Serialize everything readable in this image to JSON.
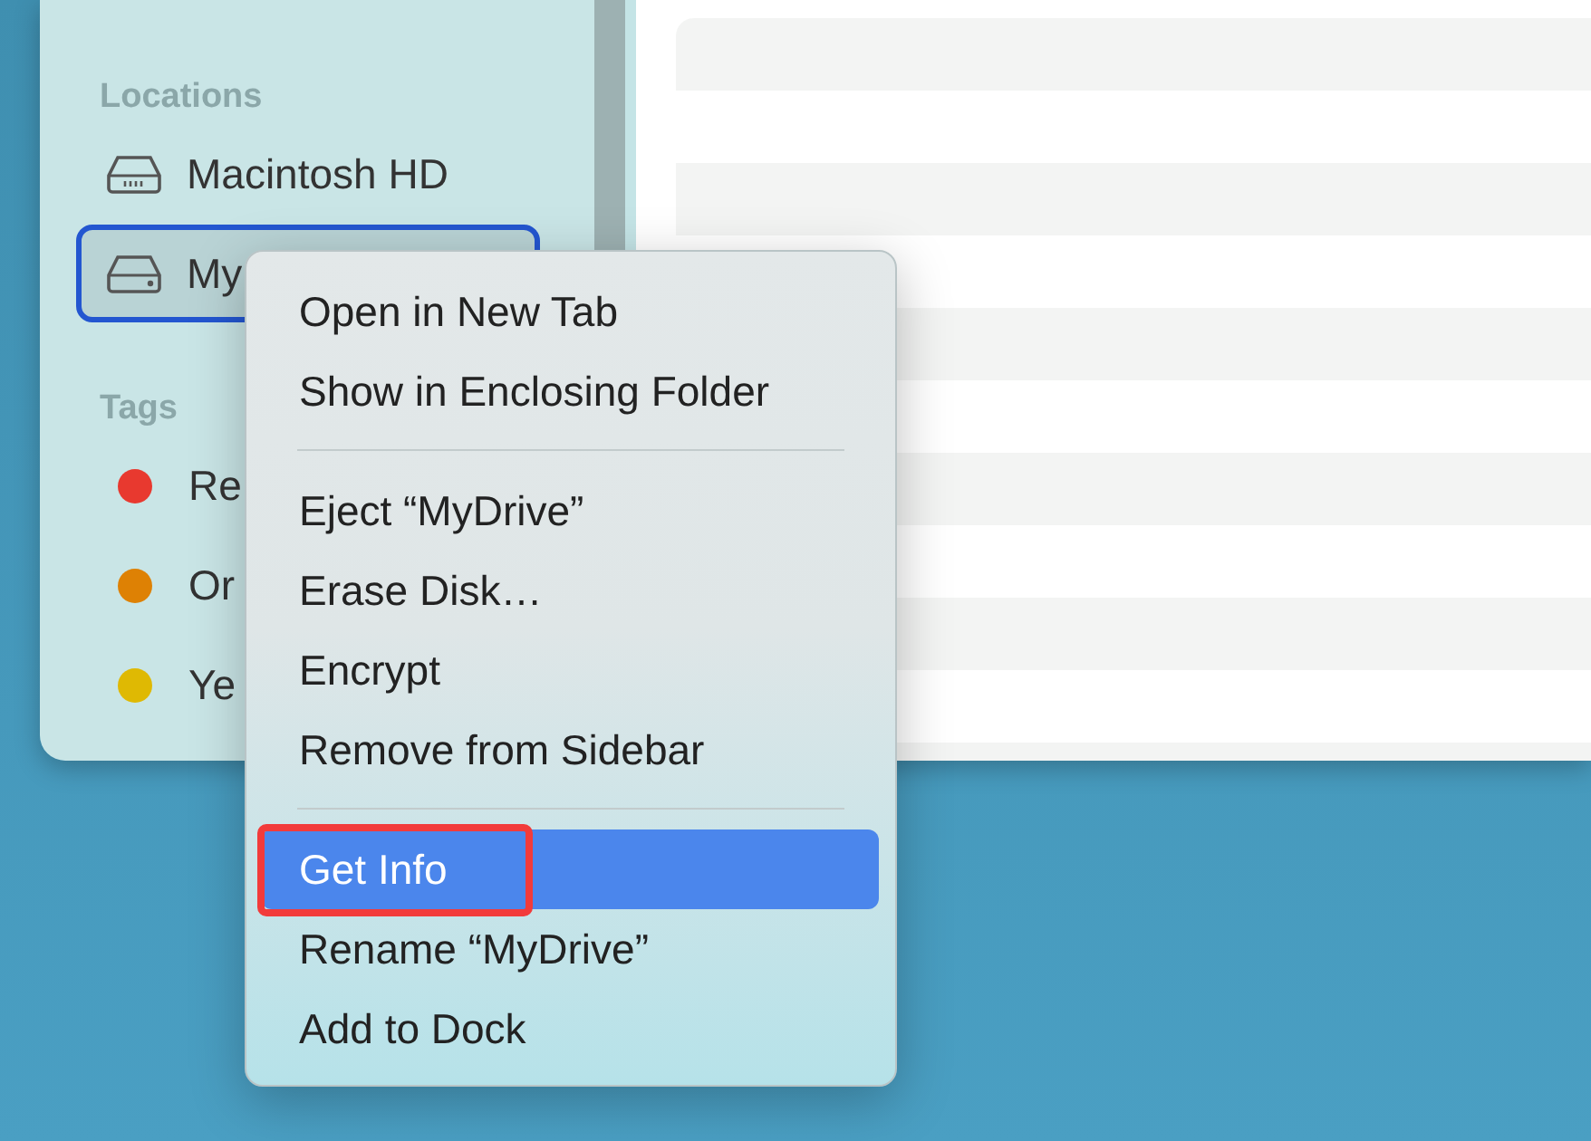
{
  "sidebar": {
    "sections": [
      {
        "header": "Locations",
        "items": [
          {
            "kind": "drive",
            "label": "Macintosh HD",
            "selected": false
          },
          {
            "kind": "external",
            "label": "My",
            "selected": true
          }
        ]
      },
      {
        "header": "Tags",
        "items": [
          {
            "kind": "tag",
            "label": "Re",
            "color": "#e8392f",
            "selected": false
          },
          {
            "kind": "tag",
            "label": "Or",
            "color": "#de8104",
            "selected": false
          },
          {
            "kind": "tag",
            "label": "Ye",
            "color": "#dfb903",
            "selected": false
          }
        ]
      }
    ]
  },
  "context_menu": {
    "items": [
      {
        "kind": "item",
        "label": "Open in New Tab",
        "selected": false,
        "annotated": false
      },
      {
        "kind": "item",
        "label": "Show in Enclosing Folder",
        "selected": false,
        "annotated": false
      },
      {
        "kind": "separator"
      },
      {
        "kind": "item",
        "label": "Eject “MyDrive”",
        "selected": false,
        "annotated": false
      },
      {
        "kind": "item",
        "label": "Erase Disk…",
        "selected": false,
        "annotated": false
      },
      {
        "kind": "item",
        "label": "Encrypt",
        "selected": false,
        "annotated": false
      },
      {
        "kind": "item",
        "label": "Remove from Sidebar",
        "selected": false,
        "annotated": false
      },
      {
        "kind": "separator"
      },
      {
        "kind": "item",
        "label": "Get Info",
        "selected": true,
        "annotated": true
      },
      {
        "kind": "item",
        "label": "Rename “MyDrive”",
        "selected": false,
        "annotated": false
      },
      {
        "kind": "item",
        "label": "Add to Dock",
        "selected": false,
        "annotated": false
      }
    ]
  }
}
